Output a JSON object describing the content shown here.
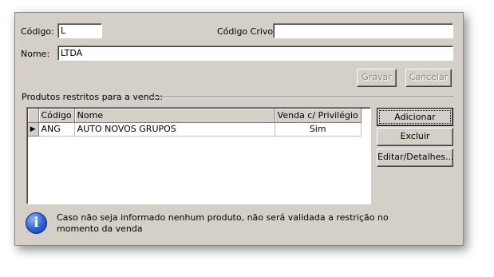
{
  "form": {
    "codigo_label": "Código:",
    "codigo_value": "L",
    "codigo_crivo_label": "Código Crivo:",
    "codigo_crivo_value": "",
    "nome_label": "Nome:",
    "nome_value": "LTDA"
  },
  "actions": {
    "gravar_label": "Gravar",
    "cancelar_label": "Cancelar"
  },
  "products": {
    "group_title": "Produtos restritos para a venda:",
    "columns": [
      "Código",
      "Nome",
      "Venda c/ Privilégio"
    ],
    "rows": [
      {
        "codigo": "ANG",
        "nome": "AUTO NOVOS GRUPOS",
        "venda": "Sim"
      }
    ],
    "selected_row_indicator": "▶"
  },
  "side_buttons": {
    "adicionar_label": "Adicionar",
    "excluir_label": "Excluir",
    "editar_label": "Editar/Detalhes..."
  },
  "info": {
    "icon": "info-icon",
    "icon_glyph": "i",
    "message_line1": "Caso não seja informado nenhum produto, não será validada a restrição no",
    "message_line2": "momento da venda"
  }
}
